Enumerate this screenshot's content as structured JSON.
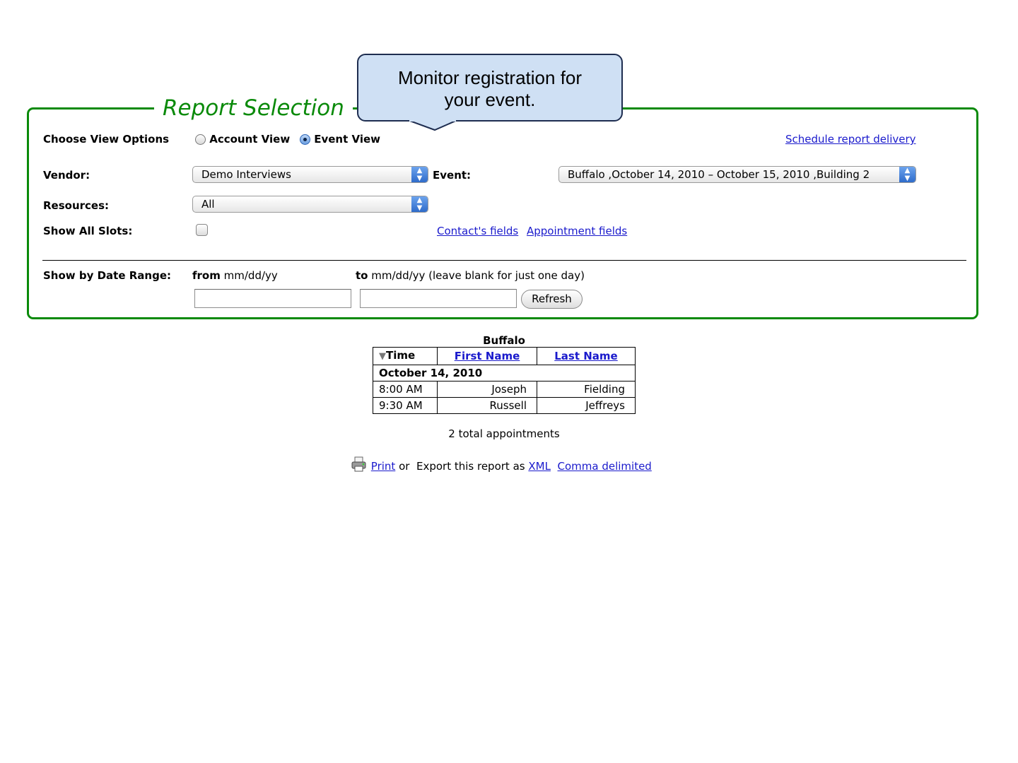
{
  "callout": {
    "line1": "Monitor registration for",
    "line2": "your event."
  },
  "report_selection": {
    "title": "Report Selection",
    "view_options_label": "Choose View Options",
    "account_view_label": "Account View",
    "event_view_label": "Event View",
    "selected_view": "Event View",
    "schedule_link": "Schedule report delivery",
    "vendor_label": "Vendor:",
    "vendor_value": "Demo Interviews",
    "event_label": "Event:",
    "event_value": "Buffalo ,October 14, 2010 – October 15, 2010 ,Building 2",
    "resources_label": "Resources:",
    "resources_value": "All",
    "show_all_slots_label": "Show All Slots:",
    "show_all_slots_checked": false,
    "contacts_fields_link": "Contact's fields",
    "appointment_fields_link": "Appointment fields",
    "date_range_label": "Show by Date Range:",
    "from_label": "from",
    "from_format": "mm/dd/yy",
    "to_label": "to",
    "to_format": "mm/dd/yy (leave blank for just one day)",
    "from_value": "",
    "to_value": "",
    "refresh_label": "Refresh"
  },
  "results": {
    "caption": "Buffalo",
    "columns": [
      "Time",
      "First Name",
      "Last Name"
    ],
    "date_group": "October 14, 2010",
    "rows": [
      {
        "time": "8:00 AM",
        "first": "Joseph",
        "last": "Fielding"
      },
      {
        "time": "9:30 AM",
        "first": "Russell",
        "last": "Jeffreys"
      }
    ],
    "total": "2 total appointments"
  },
  "export": {
    "print_link": "Print",
    "or_text": "or",
    "export_text": "Export this report as",
    "xml_link": "XML",
    "csv_link": "Comma delimited"
  },
  "icons": [
    "radio-icon",
    "sort-down-icon",
    "printer-icon"
  ]
}
